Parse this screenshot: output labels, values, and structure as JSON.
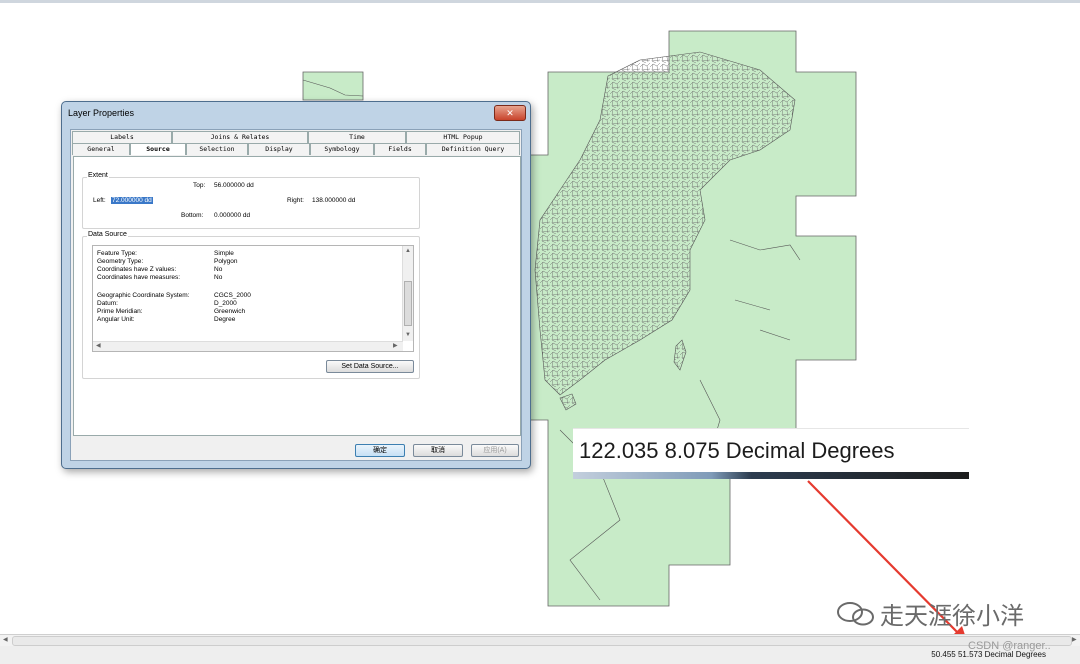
{
  "dialog": {
    "title": "Layer Properties",
    "close_glyph": "✕",
    "tabs_back": [
      "Labels",
      "Joins & Relates",
      "Time",
      "HTML Popup"
    ],
    "tabs_front": [
      "General",
      "Source",
      "Selection",
      "Display",
      "Symbology",
      "Fields",
      "Definition Query"
    ],
    "active_tab": "Source",
    "extent": {
      "group_label": "Extent",
      "top_label": "Top:",
      "top_value": "56.000000 dd",
      "left_label": "Left:",
      "left_value": "72.000000 dd",
      "right_label": "Right:",
      "right_value": "138.000000 dd",
      "bottom_label": "Bottom:",
      "bottom_value": "0.000000 dd"
    },
    "data_source": {
      "group_label": "Data Source",
      "rows": [
        {
          "key": "Feature Type:",
          "value": "Simple"
        },
        {
          "key": "Geometry Type:",
          "value": "Polygon"
        },
        {
          "key": "Coordinates have Z values:",
          "value": "No"
        },
        {
          "key": "Coordinates have measures:",
          "value": "No"
        },
        {
          "key": "Geographic Coordinate System:",
          "value": "CGCS_2000"
        },
        {
          "key": "Datum:",
          "value": "D_2000"
        },
        {
          "key": "Prime Meridian:",
          "value": "Greenwich"
        },
        {
          "key": "Angular Unit:",
          "value": "Degree"
        }
      ],
      "set_button": "Set Data Source..."
    },
    "buttons": {
      "ok": "确定",
      "cancel": "取消",
      "apply": "应用(A)"
    }
  },
  "zoom_callout": {
    "text": "122.035  8.075 Decimal Degrees"
  },
  "status_bar": {
    "coords": "50.455  51.573 Decimal Degrees"
  },
  "watermark": {
    "text": "走天涯徐小洋",
    "csdn": "CSDN @ranger.."
  },
  "colors": {
    "map_fill": "#c8ebc8",
    "map_stroke": "#555555",
    "arrow": "#e53a2f",
    "selection": "#3a78c8"
  }
}
